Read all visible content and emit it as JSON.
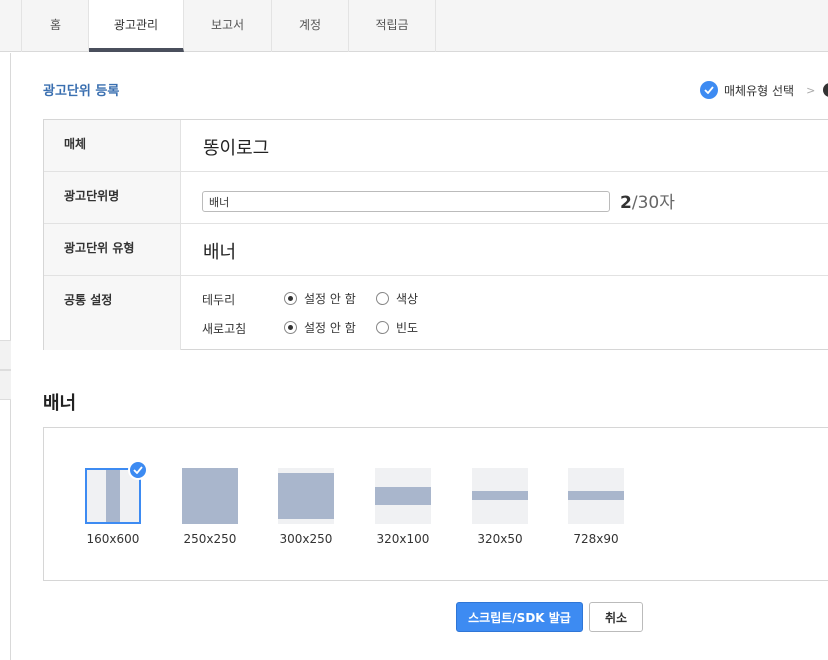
{
  "nav": {
    "tabs": [
      {
        "label": "홈"
      },
      {
        "label": "광고관리"
      },
      {
        "label": "보고서"
      },
      {
        "label": "계정"
      },
      {
        "label": "적립금"
      }
    ],
    "active": "광고관리"
  },
  "page": {
    "title": "광고단위 등록"
  },
  "steps": {
    "current": "매체유형 선택"
  },
  "form": {
    "media": {
      "label": "매체",
      "value": "똥이로그"
    },
    "unit_name": {
      "label": "광고단위명",
      "value": "배너",
      "count": "2",
      "max": "/30자"
    },
    "unit_type": {
      "label": "광고단위 유형",
      "value": "배너"
    },
    "common": {
      "label": "공통 설정",
      "border": {
        "label": "테두리",
        "opt_none": "설정 안 함",
        "opt_color": "색상"
      },
      "refresh": {
        "label": "새로고침",
        "opt_none": "설정 안 함",
        "opt_freq": "빈도"
      }
    }
  },
  "banner": {
    "title": "배너",
    "sizes": [
      {
        "label": "160x600",
        "selected": true
      },
      {
        "label": "250x250"
      },
      {
        "label": "300x250"
      },
      {
        "label": "320x100"
      },
      {
        "label": "320x50"
      },
      {
        "label": "728x90"
      }
    ]
  },
  "buttons": {
    "issue": "스크립트/SDK 발급",
    "cancel": "취소"
  },
  "colors": {
    "accent": "#3d8bf2",
    "title_blue": "#3a6fb0",
    "thumb_fill": "#a9b6cc"
  }
}
